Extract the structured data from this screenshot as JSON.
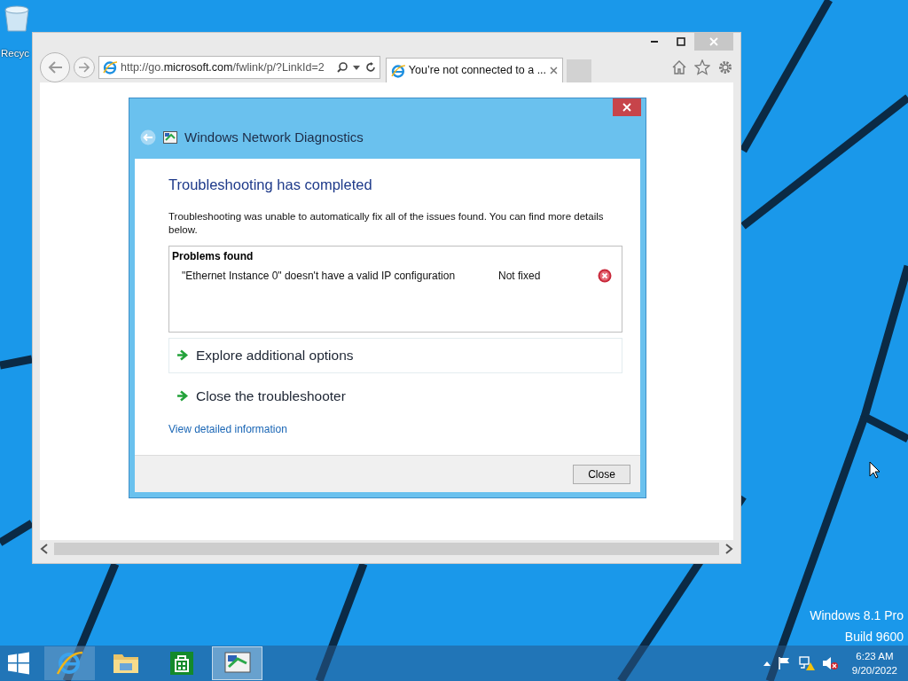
{
  "desktop": {
    "icons": [
      {
        "label": "Recyc"
      }
    ],
    "edition": "Windows 8.1 Pro",
    "build": "Build 9600"
  },
  "browser": {
    "address": "http://go.**microsoft.com**/fwlink/p/?LinkId=2",
    "tabs": [
      {
        "label": "You’re not connected to a ...",
        "selected": true
      }
    ]
  },
  "dialog": {
    "title": "Windows Network Diagnostics",
    "heading": "Troubleshooting has completed",
    "message": "Troubleshooting was unable to automatically fix all of the issues found. You can find more details below.",
    "problems": {
      "header": "Problems found",
      "rows": [
        {
          "problem": "\"Ethernet Instance 0\" doesn't have a valid IP configuration",
          "status": "Not fixed",
          "fixed": false
        }
      ]
    },
    "options": [
      {
        "label": "Explore additional options",
        "selected": true
      },
      {
        "label": "Close the troubleshooter",
        "selected": false
      }
    ],
    "link": "View detailed information",
    "buttons": [
      "Close"
    ]
  },
  "taskbar": {
    "apps": [
      {
        "kind": "browser",
        "running": true,
        "active": false
      },
      {
        "kind": "files",
        "running": false,
        "active": false
      },
      {
        "kind": "store",
        "running": false,
        "active": false
      },
      {
        "kind": "diagnostics",
        "running": true,
        "active": true
      }
    ],
    "clock": {
      "time": "6:23 AM",
      "date": "9/20/2022"
    }
  }
}
